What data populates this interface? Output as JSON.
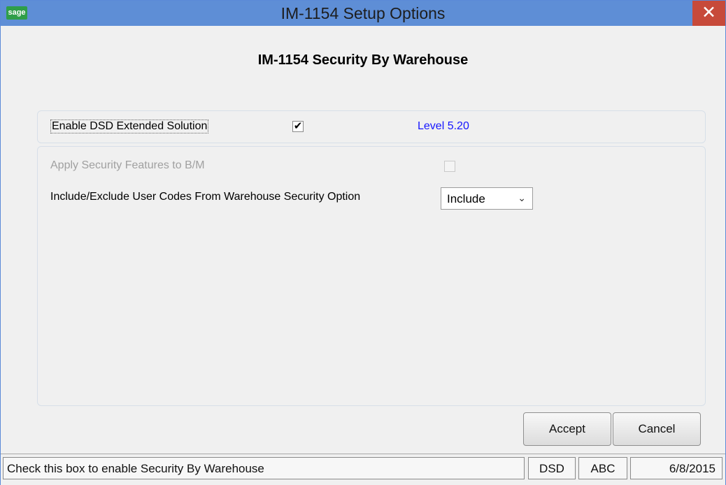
{
  "window": {
    "app_icon_text": "sage",
    "title": "IM-1154 Setup Options",
    "close_symbol": "✕"
  },
  "main": {
    "heading": "IM-1154 Security By Warehouse",
    "enable_label": "Enable DSD Extended Solution",
    "enable_checked": true,
    "check_mark": "✔",
    "level_text": "Level 5.20",
    "apply_security_label": "Apply Security Features to B/M",
    "apply_security_checked": false,
    "include_exclude_label": "Include/Exclude User Codes From Warehouse Security Option",
    "include_exclude_value": "Include",
    "dropdown_arrow": "⌄"
  },
  "buttons": {
    "accept_label": "Accept",
    "cancel_label": "Cancel"
  },
  "statusbar": {
    "message": "Check this box to enable Security By Warehouse",
    "company": "DSD",
    "code": "ABC",
    "date": "6/8/2015"
  },
  "colors": {
    "titlebar": "#5e8ed6",
    "close_button": "#c74a3a",
    "level_text": "#1515ff",
    "window_background": "#f0f0f0"
  },
  "icons": {
    "app": "sage-icon",
    "close": "close-icon",
    "checkbox_checked": "checkmark-icon",
    "dropdown": "chevron-down-icon"
  }
}
